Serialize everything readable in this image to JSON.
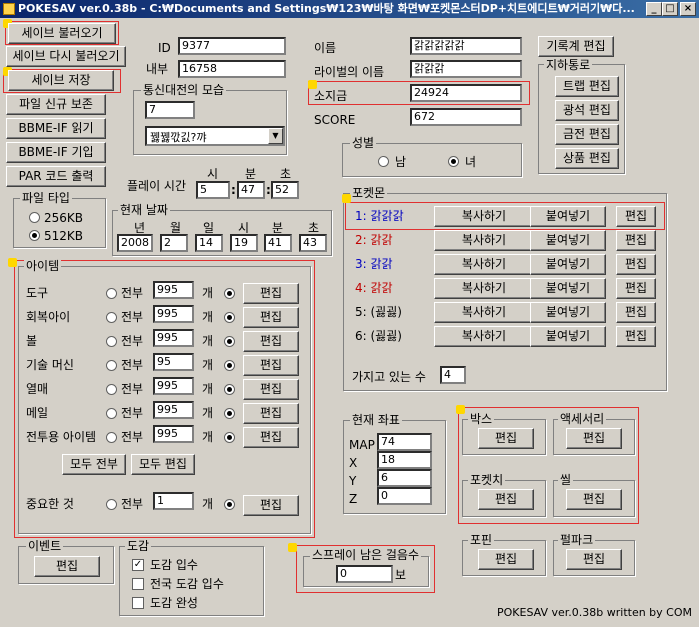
{
  "window": {
    "title": "POKESAV ver.0.38b - C:₩Documents and Settings₩123₩바탕 화면₩포켓몬스터DP+치트에디트₩거러기₩다...",
    "min": "_",
    "max": "□",
    "close": "×"
  },
  "left_buttons": {
    "load": "세이브 불러오기",
    "reload": "세이브 다시 불러오기",
    "save": "세이브 저장",
    "new_copy": "파일 신규 보존",
    "bbme_read": "BBME-IF 읽기",
    "bbme_write": "BBME-IF 기입",
    "par": "PAR 코드 출력"
  },
  "file_type": {
    "title": "파일 타입",
    "opt1": "256KB",
    "opt2": "512KB"
  },
  "ids": {
    "id_label": "ID",
    "id_value": "9377",
    "inner_label": "내부",
    "inner_value": "16758"
  },
  "comm": {
    "title": "통신대전의 모습",
    "value": "7",
    "select": "꿿꿿깏긼?꺄"
  },
  "play_time": {
    "label": "플레이 시간",
    "h_label": "시",
    "m_label": "분",
    "s_label": "초",
    "h": "5",
    "m": "47",
    "s": "52"
  },
  "date": {
    "title": "현재 날짜",
    "y_label": "년",
    "mo_label": "월",
    "d_label": "일",
    "h_label": "시",
    "mi_label": "분",
    "s_label": "초",
    "y": "2008",
    "mo": "2",
    "d": "14",
    "h": "19",
    "mi": "41",
    "s": "43"
  },
  "items": {
    "title": "아이템",
    "all": "전부",
    "unit": "개",
    "edit": "편집",
    "rows": [
      {
        "label": "도구",
        "value": "995"
      },
      {
        "label": "회복아이",
        "value": "995"
      },
      {
        "label": "볼",
        "value": "995"
      },
      {
        "label": "기술 머신",
        "value": "95"
      },
      {
        "label": "열매",
        "value": "995"
      },
      {
        "label": "메일",
        "value": "995"
      },
      {
        "label": "전투용 아이템",
        "value": "995"
      }
    ],
    "all_all": "모두 전부",
    "all_edit": "모두 편집",
    "important_label": "중요한 것",
    "important_value": "1"
  },
  "player": {
    "name_label": "이름",
    "name": "갉갉갉갉갉",
    "rival_label": "라이벌의 이름",
    "rival": "갉갉갉",
    "money_label": "소지금",
    "money": "24924",
    "score_label": "SCORE",
    "score": "672"
  },
  "record_edit": "기록계 편집",
  "underground": {
    "title": "지하통로",
    "trap": "트랩 편집",
    "stone": "광석 편집",
    "fossil": "금전 편집",
    "goods": "상품 편집"
  },
  "gender": {
    "title": "성별",
    "male": "남",
    "female": "녀"
  },
  "pokemon": {
    "title": "포켓몬",
    "copy": "복사하기",
    "paste": "붙여넣기",
    "edit": "편집",
    "rows": [
      {
        "label": "1: 갉갉갉",
        "color": "#0000c0"
      },
      {
        "label": "2: 갉갉",
        "color": "#c00000"
      },
      {
        "label": "3: 갉갉",
        "color": "#0000c0"
      },
      {
        "label": "4: 갉갉",
        "color": "#c00000"
      },
      {
        "label": "5: (굃굃)",
        "color": "#000000"
      },
      {
        "label": "6: (굃굃)",
        "color": "#000000"
      }
    ],
    "count_label": "가지고 있는 수",
    "count": "4"
  },
  "coords": {
    "title": "현재 좌표",
    "map_label": "MAP",
    "map": "74",
    "x_label": "X",
    "x": "18",
    "y_label": "Y",
    "y": "6",
    "z_label": "Z",
    "z": "0"
  },
  "boxes": {
    "box": "박스",
    "accessory": "액세서리",
    "poketch": "포켓치",
    "seal": "씰",
    "edit": "편집"
  },
  "event": {
    "title": "이벤트",
    "edit": "편집"
  },
  "dex": {
    "title": "도감",
    "entered": "도감 입수",
    "national": "전국 도감 입수",
    "complete": "도감 완성"
  },
  "spray": {
    "title": "스프레이 남은 걸음수",
    "value": "0",
    "unit": "보"
  },
  "poketwo": {
    "pofin": "포핀",
    "pal_park": "펄파크",
    "edit": "편집"
  },
  "footer": "POKESAV ver.0.38b written by COM"
}
